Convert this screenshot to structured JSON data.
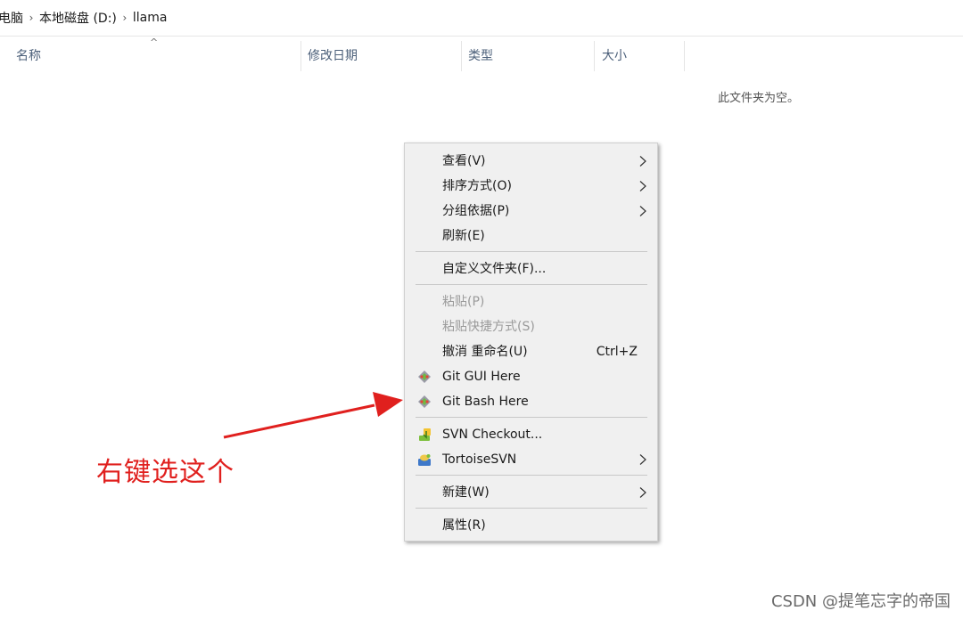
{
  "breadcrumb": {
    "items": [
      "电脑",
      "本地磁盘 (D:)",
      "llama"
    ],
    "separator_icon": "chevron-right-icon"
  },
  "columns": {
    "name": "名称",
    "date_modified": "修改日期",
    "type": "类型",
    "size": "大小",
    "sort_indicator": "^"
  },
  "empty_message": "此文件夹为空。",
  "context_menu": {
    "view": "查看(V)",
    "sort_by": "排序方式(O)",
    "group_by": "分组依据(P)",
    "refresh": "刷新(E)",
    "customize_folder": "自定义文件夹(F)...",
    "paste": "粘贴(P)",
    "paste_shortcut": "粘贴快捷方式(S)",
    "undo_rename": "撤消 重命名(U)",
    "undo_shortcut": "Ctrl+Z",
    "git_gui": "Git GUI Here",
    "git_bash": "Git Bash Here",
    "svn_checkout": "SVN Checkout...",
    "tortoise_svn": "TortoiseSVN",
    "new": "新建(W)",
    "properties": "属性(R)"
  },
  "annotation": {
    "text": "右键选这个",
    "color": "#e0201e"
  },
  "watermark": "CSDN @提笔忘字的帝国",
  "icons": {
    "git": "git-icon",
    "svn_checkout": "svn-checkout-icon",
    "tortoise": "tortoise-svn-icon",
    "submenu": "chevron-right-icon"
  }
}
